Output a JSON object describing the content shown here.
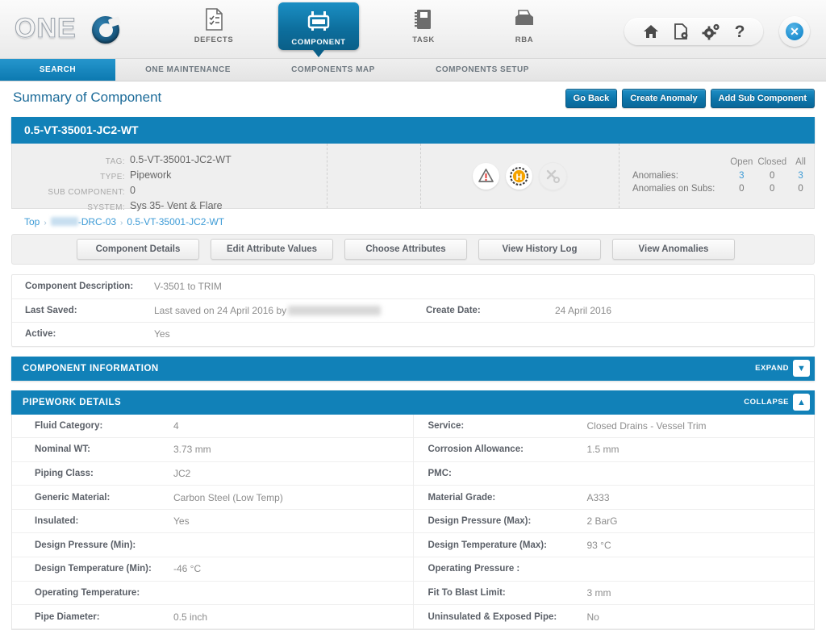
{
  "brand": {
    "logo_text": "ONE"
  },
  "topnav": {
    "items": [
      {
        "label": "DEFECTS",
        "icon": "document-checklist-icon",
        "active": false
      },
      {
        "label": "COMPONENT",
        "icon": "component-icon",
        "active": true
      },
      {
        "label": "TASK",
        "icon": "notebook-icon",
        "active": false
      },
      {
        "label": "RBA",
        "icon": "tray-icon",
        "active": false
      }
    ],
    "quick_icons": [
      "home-icon",
      "document-settings-icon",
      "gear-icon",
      "help-icon"
    ],
    "close_label": "✕"
  },
  "subnav": {
    "items": [
      {
        "label": "SEARCH",
        "active": true
      },
      {
        "label": "ONE MAINTENANCE",
        "active": false
      },
      {
        "label": "COMPONENTS MAP",
        "active": false
      },
      {
        "label": "COMPONENTS SETUP",
        "active": false
      }
    ]
  },
  "page": {
    "title": "Summary of Component",
    "actions": [
      "Go Back",
      "Create Anomaly",
      "Add Sub Component"
    ]
  },
  "component": {
    "banner_title": "0.5-VT-35001-JC2-WT",
    "summary": [
      {
        "label": "TAG:",
        "value": "0.5-VT-35001-JC2-WT"
      },
      {
        "label": "TYPE:",
        "value": "Pipework"
      },
      {
        "label": "SUB COMPONENT:",
        "value": "0"
      },
      {
        "label": "SYSTEM:",
        "value": "Sys 35- Vent & Flare"
      }
    ],
    "status_icons": [
      {
        "name": "warning-triangle-icon",
        "state": "active"
      },
      {
        "name": "hazard-h-badge-icon",
        "state": "active"
      },
      {
        "name": "tools-icon",
        "state": "disabled"
      }
    ],
    "anomalies": {
      "headers": [
        "Open",
        "Closed",
        "All"
      ],
      "rows": [
        {
          "label": "Anomalies:",
          "values": [
            "3",
            "0",
            "3"
          ]
        },
        {
          "label": "Anomalies on Subs:",
          "values": [
            "0",
            "0",
            "0"
          ]
        }
      ]
    }
  },
  "breadcrumb": {
    "top": "Top",
    "redacted_suffix": "-DRC-03",
    "current": "0.5-VT-35001-JC2-WT",
    "separator": "›"
  },
  "tabs": [
    "Component Details",
    "Edit Attribute Values",
    "Choose Attributes",
    "View History Log",
    "View Anomalies"
  ],
  "description": {
    "component_description_label": "Component Description:",
    "component_description_value": "V-3501 to TRIM",
    "last_saved_label": "Last Saved:",
    "last_saved_value": "Last saved on 24 April 2016 by",
    "create_date_label": "Create Date:",
    "create_date_value": "24 April 2016",
    "active_label": "Active:",
    "active_value": "Yes"
  },
  "sections": [
    {
      "title": "COMPONENT INFORMATION",
      "action": "EXPAND",
      "chevron": "▼",
      "state": "collapsed"
    },
    {
      "title": "PIPEWORK DETAILS",
      "action": "COLLAPSE",
      "chevron": "▲",
      "state": "expanded"
    }
  ],
  "pipework_details": {
    "left": [
      {
        "label": "Fluid Category:",
        "value": "4"
      },
      {
        "label": "Nominal WT:",
        "value": "3.73 mm"
      },
      {
        "label": "Piping Class:",
        "value": "JC2"
      },
      {
        "label": "Generic Material:",
        "value": "Carbon Steel (Low Temp)"
      },
      {
        "label": "Insulated:",
        "value": "Yes"
      },
      {
        "label": "Design Pressure (Min):",
        "value": ""
      },
      {
        "label": "Design Temperature (Min):",
        "value": "-46 °C"
      },
      {
        "label": "Operating Temperature:",
        "value": ""
      },
      {
        "label": "Pipe Diameter:",
        "value": "0.5 inch"
      }
    ],
    "right": [
      {
        "label": "Service:",
        "value": "Closed Drains - Vessel Trim"
      },
      {
        "label": "Corrosion Allowance:",
        "value": "1.5 mm"
      },
      {
        "label": "PMC:",
        "value": ""
      },
      {
        "label": "Material Grade:",
        "value": "A333"
      },
      {
        "label": "Design Pressure (Max):",
        "value": "2 BarG"
      },
      {
        "label": "Design Temperature (Max):",
        "value": "93 °C"
      },
      {
        "label": "Operating Pressure :",
        "value": ""
      },
      {
        "label": "Fit To Blast Limit:",
        "value": "3 mm"
      },
      {
        "label": "Uninsulated & Exposed Pipe:",
        "value": "No"
      }
    ]
  },
  "colors": {
    "brand_blue": "#1181b8",
    "accent_blue": "#0d76ab",
    "link_blue": "#3d9bd6",
    "title_blue": "#1c6b99",
    "warning_orange": "#f5a300",
    "alert_red": "#e53935"
  }
}
